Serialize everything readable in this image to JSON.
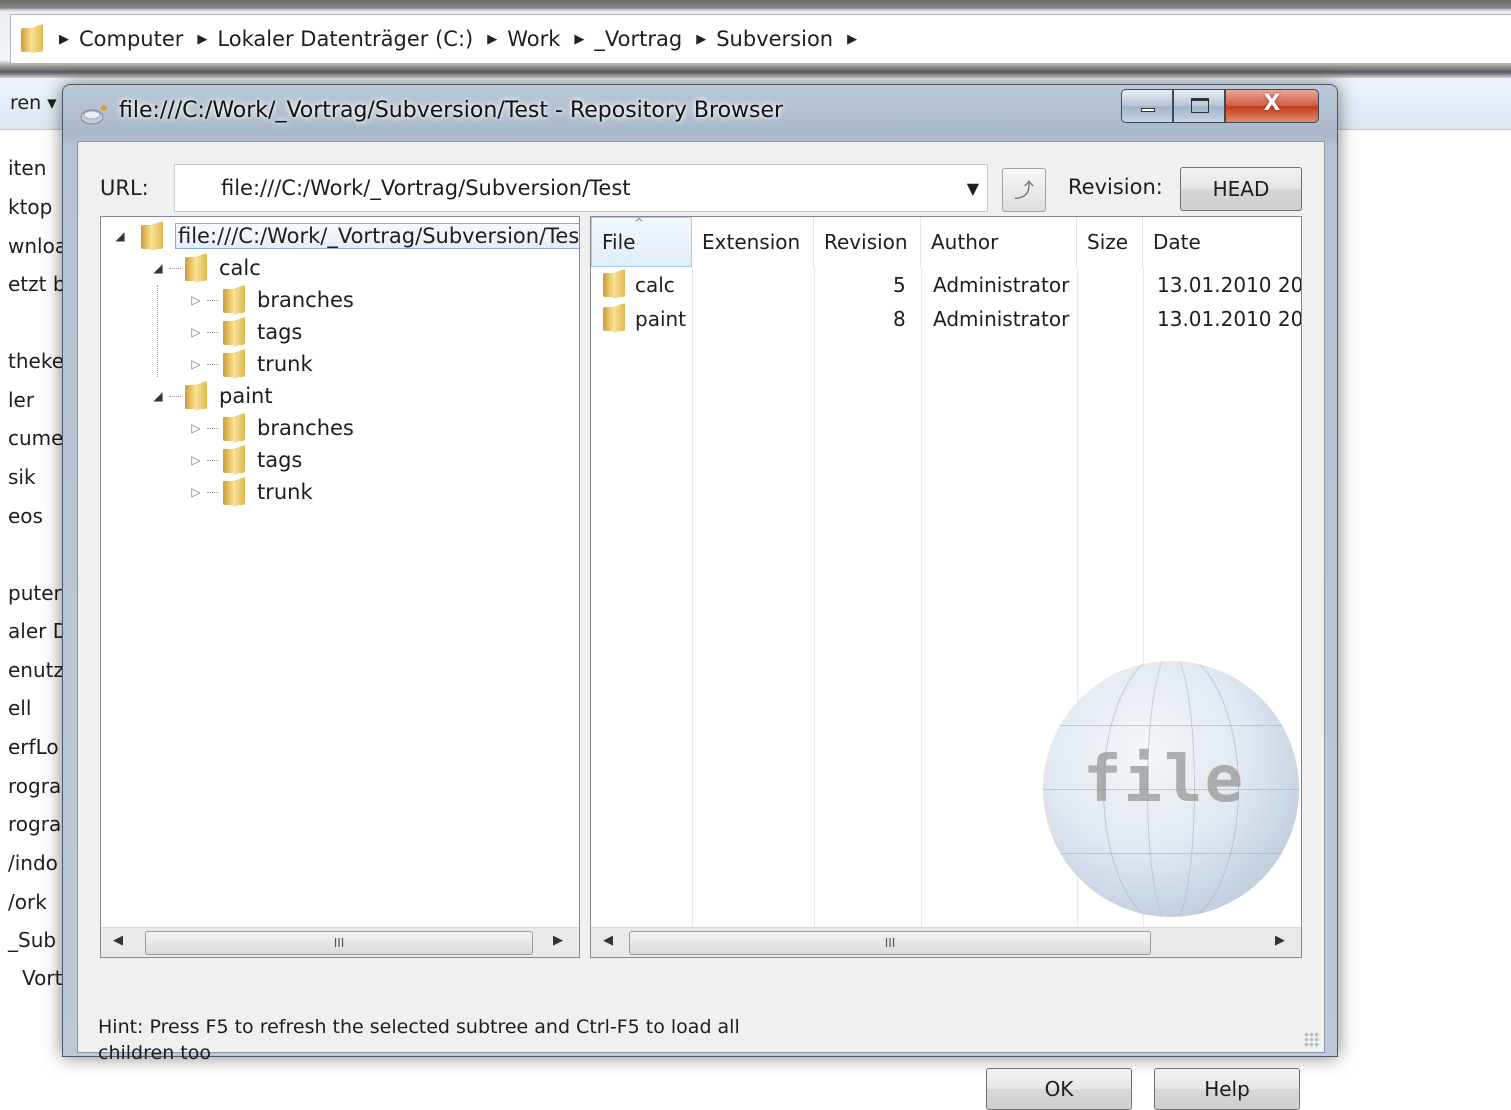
{
  "explorer": {
    "breadcrumb": [
      "Computer",
      "Lokaler Datenträger (C:)",
      "Work",
      "_Vortrag",
      "Subversion"
    ],
    "toolbar_partial": "ren ▾",
    "sidebar_partial": [
      "iten",
      "ktop",
      "wnloa",
      "etzt b",
      "theke",
      "ler",
      "cume",
      "sik",
      "eos",
      "puter",
      "aler D",
      "enutz",
      "ell",
      "erfLo",
      "rogra",
      "rogra",
      "/indo",
      "/ork",
      "_Sub",
      "Vort"
    ]
  },
  "dialog": {
    "title": "file:///C:/Work/_Vortrag/Subversion/Test - Repository Browser",
    "url_label": "URL:",
    "url_value": "file:///C:/Work/_Vortrag/Subversion/Test",
    "revision_label": "Revision:",
    "revision_value": "HEAD",
    "close_glyph": "X",
    "tree": {
      "root": "file:///C:/Work/_Vortrag/Subversion/Test",
      "nodes": [
        {
          "label": "calc",
          "children": [
            "branches",
            "tags",
            "trunk"
          ]
        },
        {
          "label": "paint",
          "children": [
            "branches",
            "tags",
            "trunk"
          ]
        }
      ]
    },
    "list": {
      "columns": [
        "File",
        "Extension",
        "Revision",
        "Author",
        "Size",
        "Date"
      ],
      "rows": [
        {
          "file": "calc",
          "extension": "",
          "revision": "5",
          "author": "Administrator",
          "size": "",
          "date": "13.01.2010 20"
        },
        {
          "file": "paint",
          "extension": "",
          "revision": "8",
          "author": "Administrator",
          "size": "",
          "date": "13.01.2010 20"
        }
      ]
    },
    "watermark_text": "file",
    "scroll_thumb_glyph": "III",
    "hint": "Hint: Press F5 to refresh the selected subtree and Ctrl-F5 to load all children too",
    "ok_label": "OK",
    "help_label": "Help"
  }
}
